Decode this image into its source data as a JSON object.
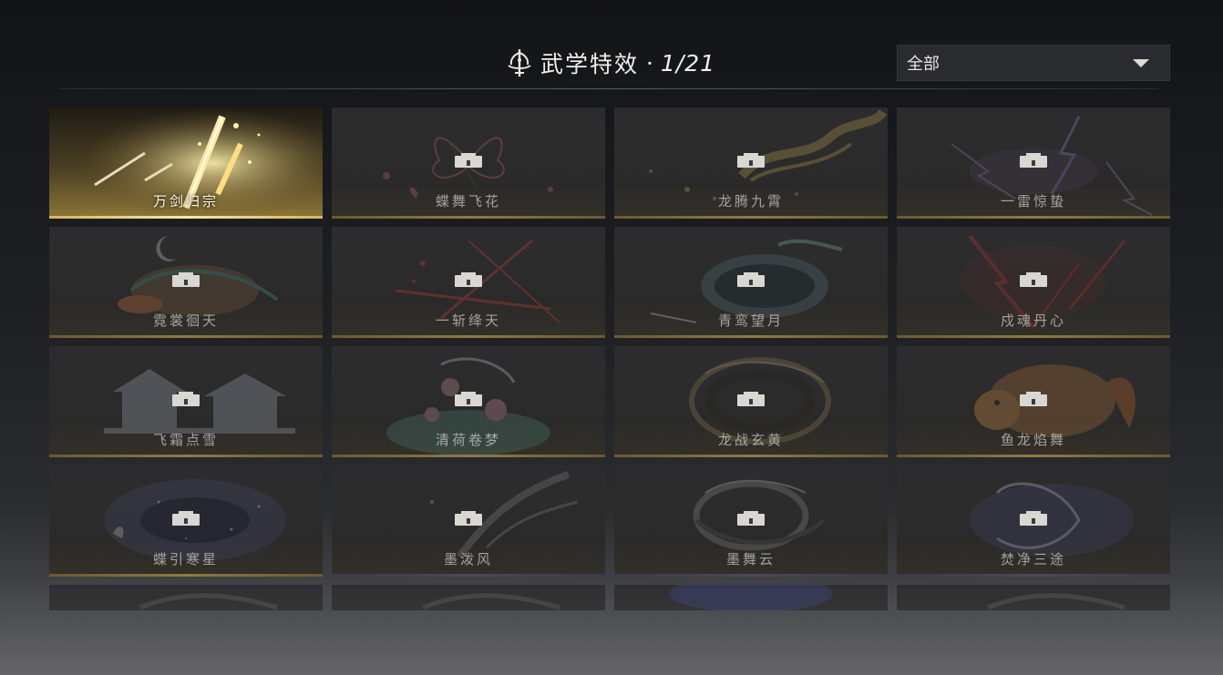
{
  "header": {
    "title": "武学特效",
    "separator": "·",
    "count": "1/21"
  },
  "filter": {
    "selected": "全部"
  },
  "cards": [
    {
      "name": "万剑归宗",
      "unlocked": true,
      "art": "golden-swords",
      "color": "#e6c466"
    },
    {
      "name": "蝶舞飞花",
      "unlocked": false,
      "art": "pink-butterfly",
      "color": "#d46a7e"
    },
    {
      "name": "龙腾九霄",
      "unlocked": false,
      "art": "golden-dragon",
      "color": "#c9a84e"
    },
    {
      "name": "一雷惊蛰",
      "unlocked": false,
      "art": "purple-lightning",
      "color": "#9a86d8"
    },
    {
      "name": "霓裳徊天",
      "unlocked": false,
      "art": "moon-dancer",
      "color": "#c98a52"
    },
    {
      "name": "一斩绛天",
      "unlocked": false,
      "art": "red-slash",
      "color": "#d8453a"
    },
    {
      "name": "青鸾望月",
      "unlocked": false,
      "art": "teal-moon",
      "color": "#6fa6b2"
    },
    {
      "name": "戍魂丹心",
      "unlocked": false,
      "art": "red-lightning",
      "color": "#d4382e"
    },
    {
      "name": "飞霜点雪",
      "unlocked": false,
      "art": "frost-palace",
      "color": "#a9b3bd"
    },
    {
      "name": "清荷卷梦",
      "unlocked": false,
      "art": "lotus",
      "color": "#5fa89a"
    },
    {
      "name": "龙战玄黄",
      "unlocked": false,
      "art": "dark-ring",
      "color": "#9b8452"
    },
    {
      "name": "鱼龙焰舞",
      "unlocked": false,
      "art": "koi-fish",
      "color": "#d8863a"
    },
    {
      "name": "蝶引寒星",
      "unlocked": false,
      "art": "star-galaxy",
      "color": "#5f6aa8"
    },
    {
      "name": "墨泼风",
      "unlocked": false,
      "art": "ink-splash",
      "color": "#8a8a8a"
    },
    {
      "name": "墨舞云",
      "unlocked": false,
      "art": "ink-swirl",
      "color": "#8f8f8f"
    },
    {
      "name": "焚净三途",
      "unlocked": false,
      "art": "blue-flame",
      "color": "#6a6fd0"
    },
    {
      "name": "",
      "unlocked": false,
      "art": "ink-partial",
      "color": "#777777"
    },
    {
      "name": "",
      "unlocked": false,
      "art": "ink-partial",
      "color": "#777777"
    },
    {
      "name": "",
      "unlocked": false,
      "art": "blue-partial",
      "color": "#4a55c8"
    },
    {
      "name": "",
      "unlocked": false,
      "art": "ink-partial",
      "color": "#777777"
    }
  ]
}
